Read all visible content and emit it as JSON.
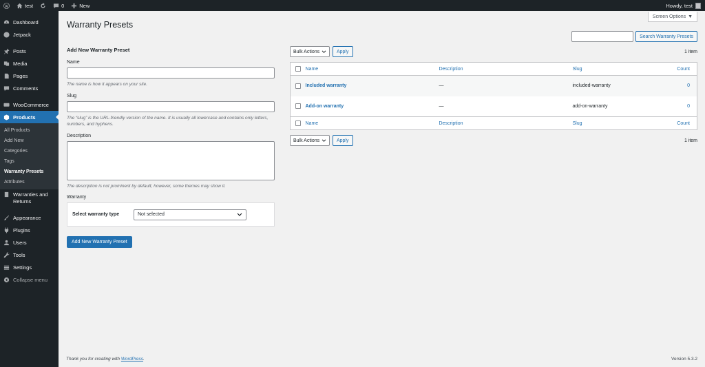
{
  "adminbar": {
    "site_name": "test",
    "comments_count": "0",
    "new_label": "New",
    "howdy": "Howdy, test"
  },
  "sidebar": {
    "dashboard": "Dashboard",
    "jetpack": "Jetpack",
    "posts": "Posts",
    "media": "Media",
    "pages": "Pages",
    "comments": "Comments",
    "woocommerce": "WooCommerce",
    "products": "Products",
    "submenu": [
      "All Products",
      "Add New",
      "Categories",
      "Tags",
      "Warranty Presets",
      "Attributes"
    ],
    "warranties": "Warranties and Returns",
    "appearance": "Appearance",
    "plugins": "Plugins",
    "users": "Users",
    "tools": "Tools",
    "settings": "Settings",
    "collapse": "Collapse menu"
  },
  "header": {
    "title": "Warranty Presets",
    "screen_options": "Screen Options"
  },
  "search": {
    "button": "Search Warranty Presets"
  },
  "form": {
    "heading": "Add New Warranty Preset",
    "name_label": "Name",
    "name_desc": "The name is how it appears on your site.",
    "slug_label": "Slug",
    "slug_desc": "The “slug” is the URL-friendly version of the name. It is usually all lowercase and contains only letters, numbers, and hyphens.",
    "description_label": "Description",
    "description_desc": "The description is not prominent by default; however, some themes may show it.",
    "warranty_label": "Warranty",
    "warranty_type_label": "Select warranty type",
    "warranty_type_value": "Not selected",
    "submit": "Add New Warranty Preset"
  },
  "list": {
    "bulk_actions": "Bulk Actions",
    "apply": "Apply",
    "items_count": "1 item",
    "columns": [
      "Name",
      "Description",
      "Slug",
      "Count"
    ],
    "rows": [
      {
        "name": "Included warranty",
        "description": "—",
        "slug": "included-warranty",
        "count": "0"
      },
      {
        "name": "Add-on warranty",
        "description": "—",
        "slug": "add-on-warranty",
        "count": "0"
      }
    ]
  },
  "footer": {
    "thanks_prefix": "Thank you for creating with ",
    "wordpress_link": "WordPress",
    "thanks_suffix": ".",
    "version": "Version 5.3.2"
  },
  "colors": {
    "accent": "#2271b1",
    "adminbar": "#1d2327",
    "background": "#f1f1f1"
  }
}
